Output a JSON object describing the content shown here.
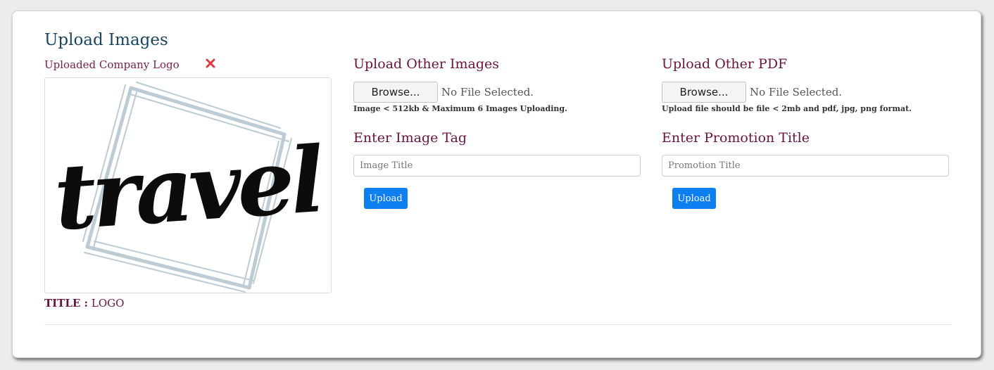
{
  "page": {
    "title": "Upload Images"
  },
  "logo": {
    "label": "Uploaded Company Logo",
    "remove_icon": "close-icon",
    "image_text": "travel",
    "title_key": "TITLE :",
    "title_value": "LOGO"
  },
  "other_images": {
    "heading": "Upload Other Images",
    "browse_label": "Browse...",
    "file_status": "No File Selected.",
    "hint": "Image < 512kb & Maximum 6 Images Uploading.",
    "tag_heading": "Enter Image Tag",
    "tag_placeholder": "Image Title",
    "upload_label": "Upload"
  },
  "other_pdf": {
    "heading": "Upload Other PDF",
    "browse_label": "Browse...",
    "file_status": "No File Selected.",
    "hint": "Upload file should be file < 2mb and pdf, jpg, png format.",
    "title_heading": "Enter Promotion Title",
    "title_placeholder": "Promotion Title",
    "upload_label": "Upload"
  },
  "colors": {
    "heading_blue": "#1b4560",
    "label_maroon": "#6b1340",
    "accent_blue": "#0d7ff0",
    "remove_red": "#e0383e"
  }
}
